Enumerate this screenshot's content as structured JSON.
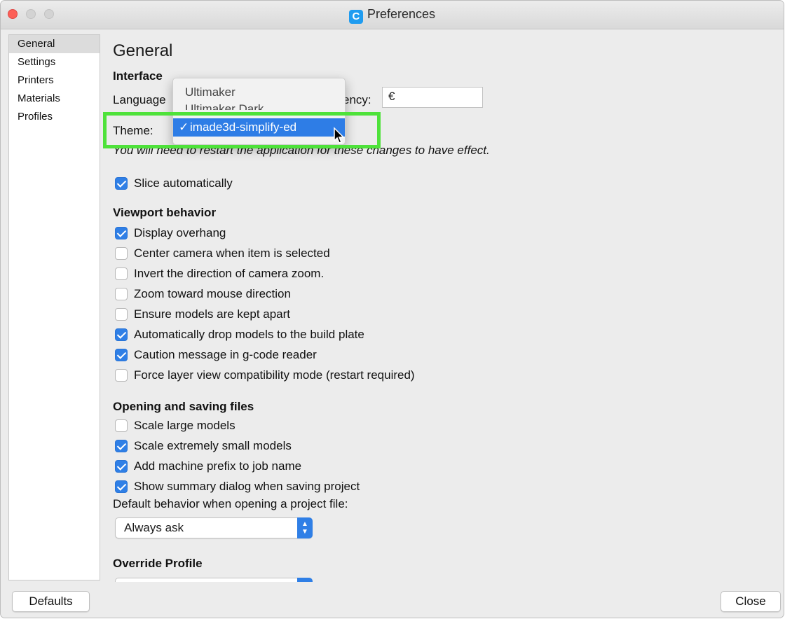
{
  "window": {
    "title": "Preferences",
    "app_icon_letter": "C"
  },
  "sidebar": {
    "items": [
      {
        "label": "General"
      },
      {
        "label": "Settings"
      },
      {
        "label": "Printers"
      },
      {
        "label": "Materials"
      },
      {
        "label": "Profiles"
      }
    ],
    "selected": "General"
  },
  "main": {
    "title": "General",
    "interface": {
      "heading": "Interface",
      "language_label": "Language",
      "currency_label": "ency:",
      "currency_value": "€",
      "theme_label": "Theme:",
      "restart_note": "You will need to restart the application for these changes to have effect."
    },
    "theme_popup": {
      "options": [
        "Ultimaker",
        "Ultimaker Dark",
        "imade3d-simplify-ed"
      ],
      "selected": "imade3d-simplify-ed",
      "check": "✓"
    },
    "slice_auto": {
      "label": "Slice automatically",
      "checked": true
    },
    "viewport": {
      "heading": "Viewport behavior",
      "options": [
        {
          "label": "Display overhang",
          "checked": true
        },
        {
          "label": "Center camera when item is selected",
          "checked": false
        },
        {
          "label": "Invert the direction of camera zoom.",
          "checked": false
        },
        {
          "label": "Zoom toward mouse direction",
          "checked": false
        },
        {
          "label": "Ensure models are kept apart",
          "checked": false
        },
        {
          "label": "Automatically drop models to the build plate",
          "checked": true
        },
        {
          "label": "Caution message in g-code reader",
          "checked": true
        },
        {
          "label": "Force layer view compatibility mode (restart required)",
          "checked": false
        }
      ]
    },
    "files": {
      "heading": "Opening and saving files",
      "options": [
        {
          "label": "Scale large models",
          "checked": false
        },
        {
          "label": "Scale extremely small models",
          "checked": true
        },
        {
          "label": "Add machine prefix to job name",
          "checked": true
        },
        {
          "label": "Show summary dialog when saving project",
          "checked": true
        }
      ],
      "default_behavior_label": "Default behavior when opening a project file:",
      "default_behavior_value": "Always ask"
    },
    "override": {
      "heading": "Override Profile"
    }
  },
  "footer": {
    "defaults_label": "Defaults",
    "close_label": "Close"
  },
  "colors": {
    "accent": "#2f7fe6",
    "highlight_box": "#4ee23a",
    "close_light": "#fc5f57"
  }
}
